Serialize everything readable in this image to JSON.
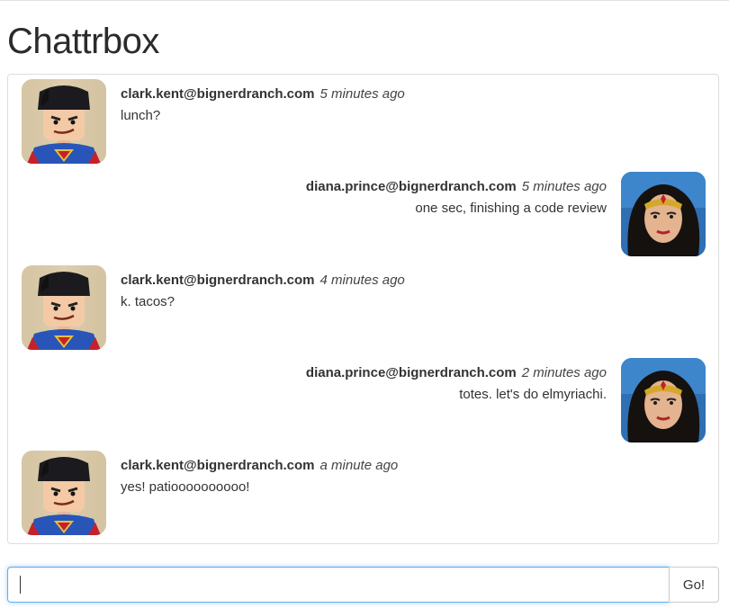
{
  "app": {
    "title": "Chattrbox"
  },
  "messages": [
    {
      "sender": "clark.kent@bignerdranch.com",
      "time": "5 minutes ago",
      "text": "lunch?",
      "direction": "incoming",
      "avatar": "superman-lego-avatar"
    },
    {
      "sender": "diana.prince@bignerdranch.com",
      "time": "5 minutes ago",
      "text": "one sec, finishing a code review",
      "direction": "outgoing",
      "avatar": "wonder-woman-figure-avatar"
    },
    {
      "sender": "clark.kent@bignerdranch.com",
      "time": "4 minutes ago",
      "text": "k. tacos?",
      "direction": "incoming",
      "avatar": "superman-lego-avatar"
    },
    {
      "sender": "diana.prince@bignerdranch.com",
      "time": "2 minutes ago",
      "text": "totes. let's do elmyriachi.",
      "direction": "outgoing",
      "avatar": "wonder-woman-figure-avatar"
    },
    {
      "sender": "clark.kent@bignerdranch.com",
      "time": "a minute ago",
      "text": "yes! patioooooooooo!",
      "direction": "incoming",
      "avatar": "superman-lego-avatar"
    }
  ],
  "composer": {
    "value": "",
    "submit_label": "Go!"
  },
  "colors": {
    "focus_border": "#66afe9",
    "panel_border": "#dddddd",
    "text": "#333333"
  }
}
